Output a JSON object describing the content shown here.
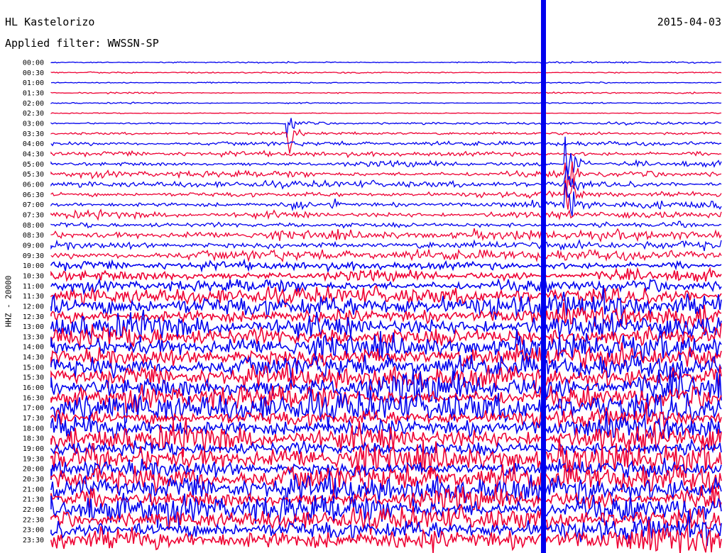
{
  "header": {
    "station": "HL Kastelorizo",
    "date": "2015-04-03",
    "filter": "Applied filter: WWSSN-SP"
  },
  "chart_data": {
    "type": "line",
    "title": "HL Kastelorizo",
    "ylabel": "HHZ - 20000",
    "row_labels": [
      "00:00",
      "00:30",
      "01:00",
      "01:30",
      "02:00",
      "02:30",
      "03:00",
      "03:30",
      "04:00",
      "04:30",
      "05:00",
      "05:30",
      "06:00",
      "06:30",
      "07:00",
      "07:30",
      "08:00",
      "08:30",
      "09:00",
      "09:30",
      "10:00",
      "10:30",
      "11:00",
      "11:30",
      "12:00",
      "12:30",
      "13:00",
      "13:30",
      "14:00",
      "14:30",
      "15:00",
      "15:30",
      "16:00",
      "16:30",
      "17:00",
      "17:30",
      "18:00",
      "18:30",
      "19:00",
      "19:30",
      "20:00",
      "20:30",
      "21:00",
      "21:30",
      "22:00",
      "22:30",
      "23:00",
      "23:30"
    ],
    "series_colors": [
      "#0000ee",
      "#ee0033"
    ],
    "events": [
      {
        "row": "03:30",
        "label": "earthquake-1"
      },
      {
        "row": "06:30",
        "label": "earthquake-2"
      }
    ]
  }
}
